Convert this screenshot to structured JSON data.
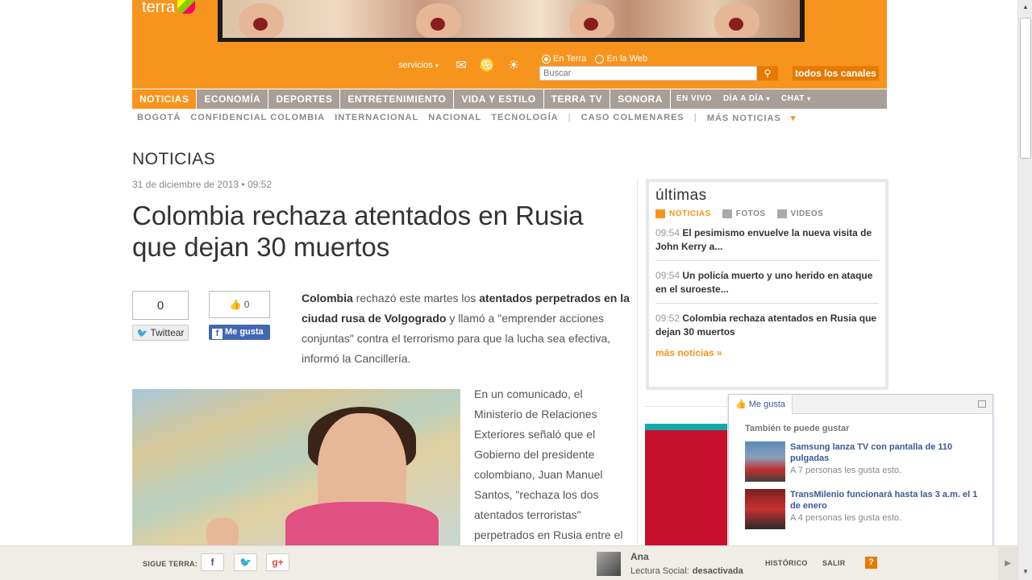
{
  "header": {
    "logo": "terra",
    "servicios": "servicios",
    "radio_options": [
      "En Terra",
      "En la Web"
    ],
    "search_placeholder": "Buscar",
    "canales_label": "todos los canales"
  },
  "nav": {
    "items": [
      "NOTICIAS",
      "ECONOMÍA",
      "DEPORTES",
      "ENTRETENIMIENTO",
      "VIDA Y ESTILO",
      "TERRA TV",
      "SONORA"
    ],
    "small_items": [
      "EN VIVO",
      "DÍA A DÍA",
      "CHAT"
    ]
  },
  "subnav": {
    "items": [
      "BOGOTÁ",
      "CONFIDENCIAL COLOMBIA",
      "INTERNACIONAL",
      "NACIONAL",
      "TECNOLOGÍA"
    ],
    "caso": "CASO COLMENARES",
    "more": "MÁS NOTICIAS"
  },
  "article": {
    "section": "NOTICIAS",
    "date": "31 de diciembre de 2013 • 09:52",
    "title": "Colombia rechaza atentados en Rusia que dejan 30 muertos",
    "tweet_count": "0",
    "tweet_label": "Twittear",
    "like_count": "0",
    "like_label": "Me gusta",
    "lead": {
      "b1": "Colombia",
      "t1": " rechazó este martes los ",
      "b2": "atentados perpetrados en la ciudad rusa de Volgogrado",
      "t2": " y llamó a \"emprender acciones conjuntas\" contra el terrorismo para que la lucha sea efectiva, informó la Cancillería."
    },
    "body": "En un comunicado, el Ministerio de Relaciones Exteriores señaló que el Gobierno del presidente colombiano, Juan Manuel Santos, \"rechaza los dos atentados terroristas\" perpetrados en Rusia entre el"
  },
  "sidebar": {
    "title": "últimas",
    "tabs": [
      "NOTICIAS",
      "FOTOS",
      "VIDEOS"
    ],
    "news": [
      {
        "time": "09:54",
        "text": "El pesimismo envuelve la nueva visita de John Kerry a..."
      },
      {
        "time": "09:54",
        "text": "Un policía muerto y uno herido en ataque en el suroeste..."
      },
      {
        "time": "09:52",
        "text": "Colombia rechaza atentados en Rusia que dejan 30 muertos"
      }
    ],
    "more": "más noticias »"
  },
  "fb_popup": {
    "like": "Me gusta",
    "heading": "También te puede gustar",
    "recs": [
      {
        "title": "Samsung lanza TV con pantalla de 110 pulgadas",
        "sub": "A 7 personas les gusta esto."
      },
      {
        "title": "TransMilenio funcionará hasta las 3 a.m. el 1 de enero",
        "sub": "A 4 personas les gusta esto."
      }
    ]
  },
  "bottom": {
    "sigue": "SIGUE TERRA:",
    "user": "Ana",
    "lectura_label": "Lectura Social:",
    "lectura_value": "desactivada",
    "historico": "HISTÓRICO",
    "salir": "SALIR",
    "help": "?"
  }
}
